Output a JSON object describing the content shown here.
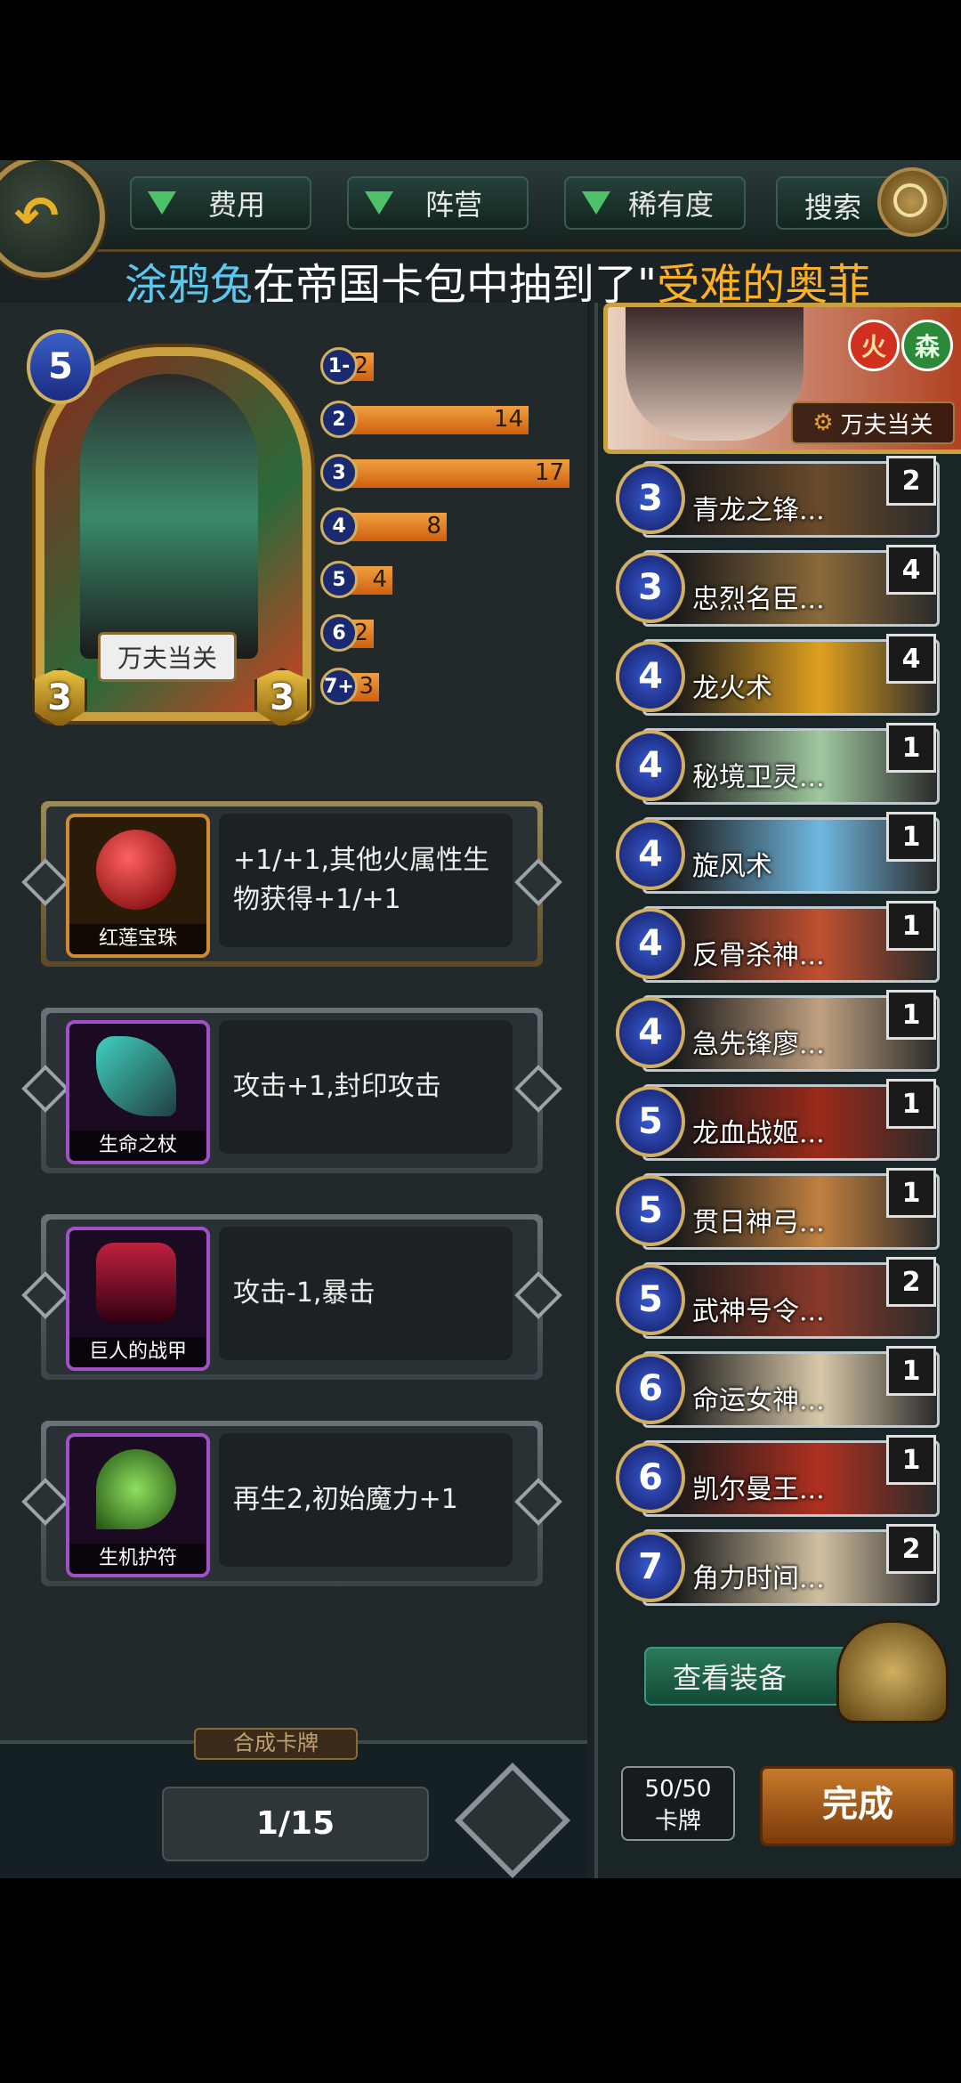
{
  "filters": [
    {
      "label": "费用"
    },
    {
      "label": "阵营"
    },
    {
      "label": "稀有度"
    }
  ],
  "search_label": "搜索",
  "marquee": {
    "name": "涂鸦兔",
    "middle": "在帝国卡包中抽到了\"",
    "card": "受难的奥菲"
  },
  "hero": {
    "cost": "5",
    "name": "万夫当关",
    "attack": "3",
    "health": "3"
  },
  "mana_curve": [
    {
      "cost": "1-",
      "count": 2
    },
    {
      "cost": "2",
      "count": 14
    },
    {
      "cost": "3",
      "count": 17
    },
    {
      "cost": "4",
      "count": 8
    },
    {
      "cost": "5",
      "count": 4
    },
    {
      "cost": "6",
      "count": 2
    },
    {
      "cost": "7+",
      "count": 3
    }
  ],
  "equipment": [
    {
      "name": "红莲宝珠",
      "desc": "+1/+1,其他火属性生物获得+1/+1",
      "color": "#d02020"
    },
    {
      "name": "生命之杖",
      "desc": "攻击+1,封印攻击",
      "color": "#30b0a0"
    },
    {
      "name": "巨人的战甲",
      "desc": "攻击-1,暴击",
      "color": "#a02040"
    },
    {
      "name": "生机护符",
      "desc": "再生2,初始魔力+1",
      "color": "#60b030"
    }
  ],
  "craft_label": "合成卡牌",
  "page_indicator": "1/15",
  "hero_banner": {
    "fire": "火",
    "forest": "森",
    "name": "万夫当关"
  },
  "cards": [
    {
      "cost": "3",
      "name": "青龙之锋...",
      "count": "2",
      "bg": "#6a4a2a"
    },
    {
      "cost": "3",
      "name": "忠烈名臣...",
      "count": "4",
      "bg": "#8a6a3a"
    },
    {
      "cost": "4",
      "name": "龙火术",
      "count": "4",
      "bg": "#e0a020"
    },
    {
      "cost": "4",
      "name": "秘境卫灵...",
      "count": "1",
      "bg": "#a0c8a0"
    },
    {
      "cost": "4",
      "name": "旋风术",
      "count": "1",
      "bg": "#70b8e0"
    },
    {
      "cost": "4",
      "name": "反骨杀神...",
      "count": "1",
      "bg": "#c05030"
    },
    {
      "cost": "4",
      "name": "急先锋廖...",
      "count": "1",
      "bg": "#c0a080"
    },
    {
      "cost": "5",
      "name": "龙血战姬...",
      "count": "1",
      "bg": "#9a2a1a"
    },
    {
      "cost": "5",
      "name": "贯日神弓...",
      "count": "1",
      "bg": "#c08040"
    },
    {
      "cost": "5",
      "name": "武神号令...",
      "count": "2",
      "bg": "#8a3a2a"
    },
    {
      "cost": "6",
      "name": "命运女神...",
      "count": "1",
      "bg": "#d8c8a8"
    },
    {
      "cost": "6",
      "name": "凯尔曼王...",
      "count": "1",
      "bg": "#b03020"
    },
    {
      "cost": "7",
      "name": "角力时间...",
      "count": "2",
      "bg": "#d0c0a0"
    }
  ],
  "view_equip_label": "查看装备",
  "deck_count": {
    "value": "50/50",
    "label": "卡牌"
  },
  "done_label": "完成"
}
